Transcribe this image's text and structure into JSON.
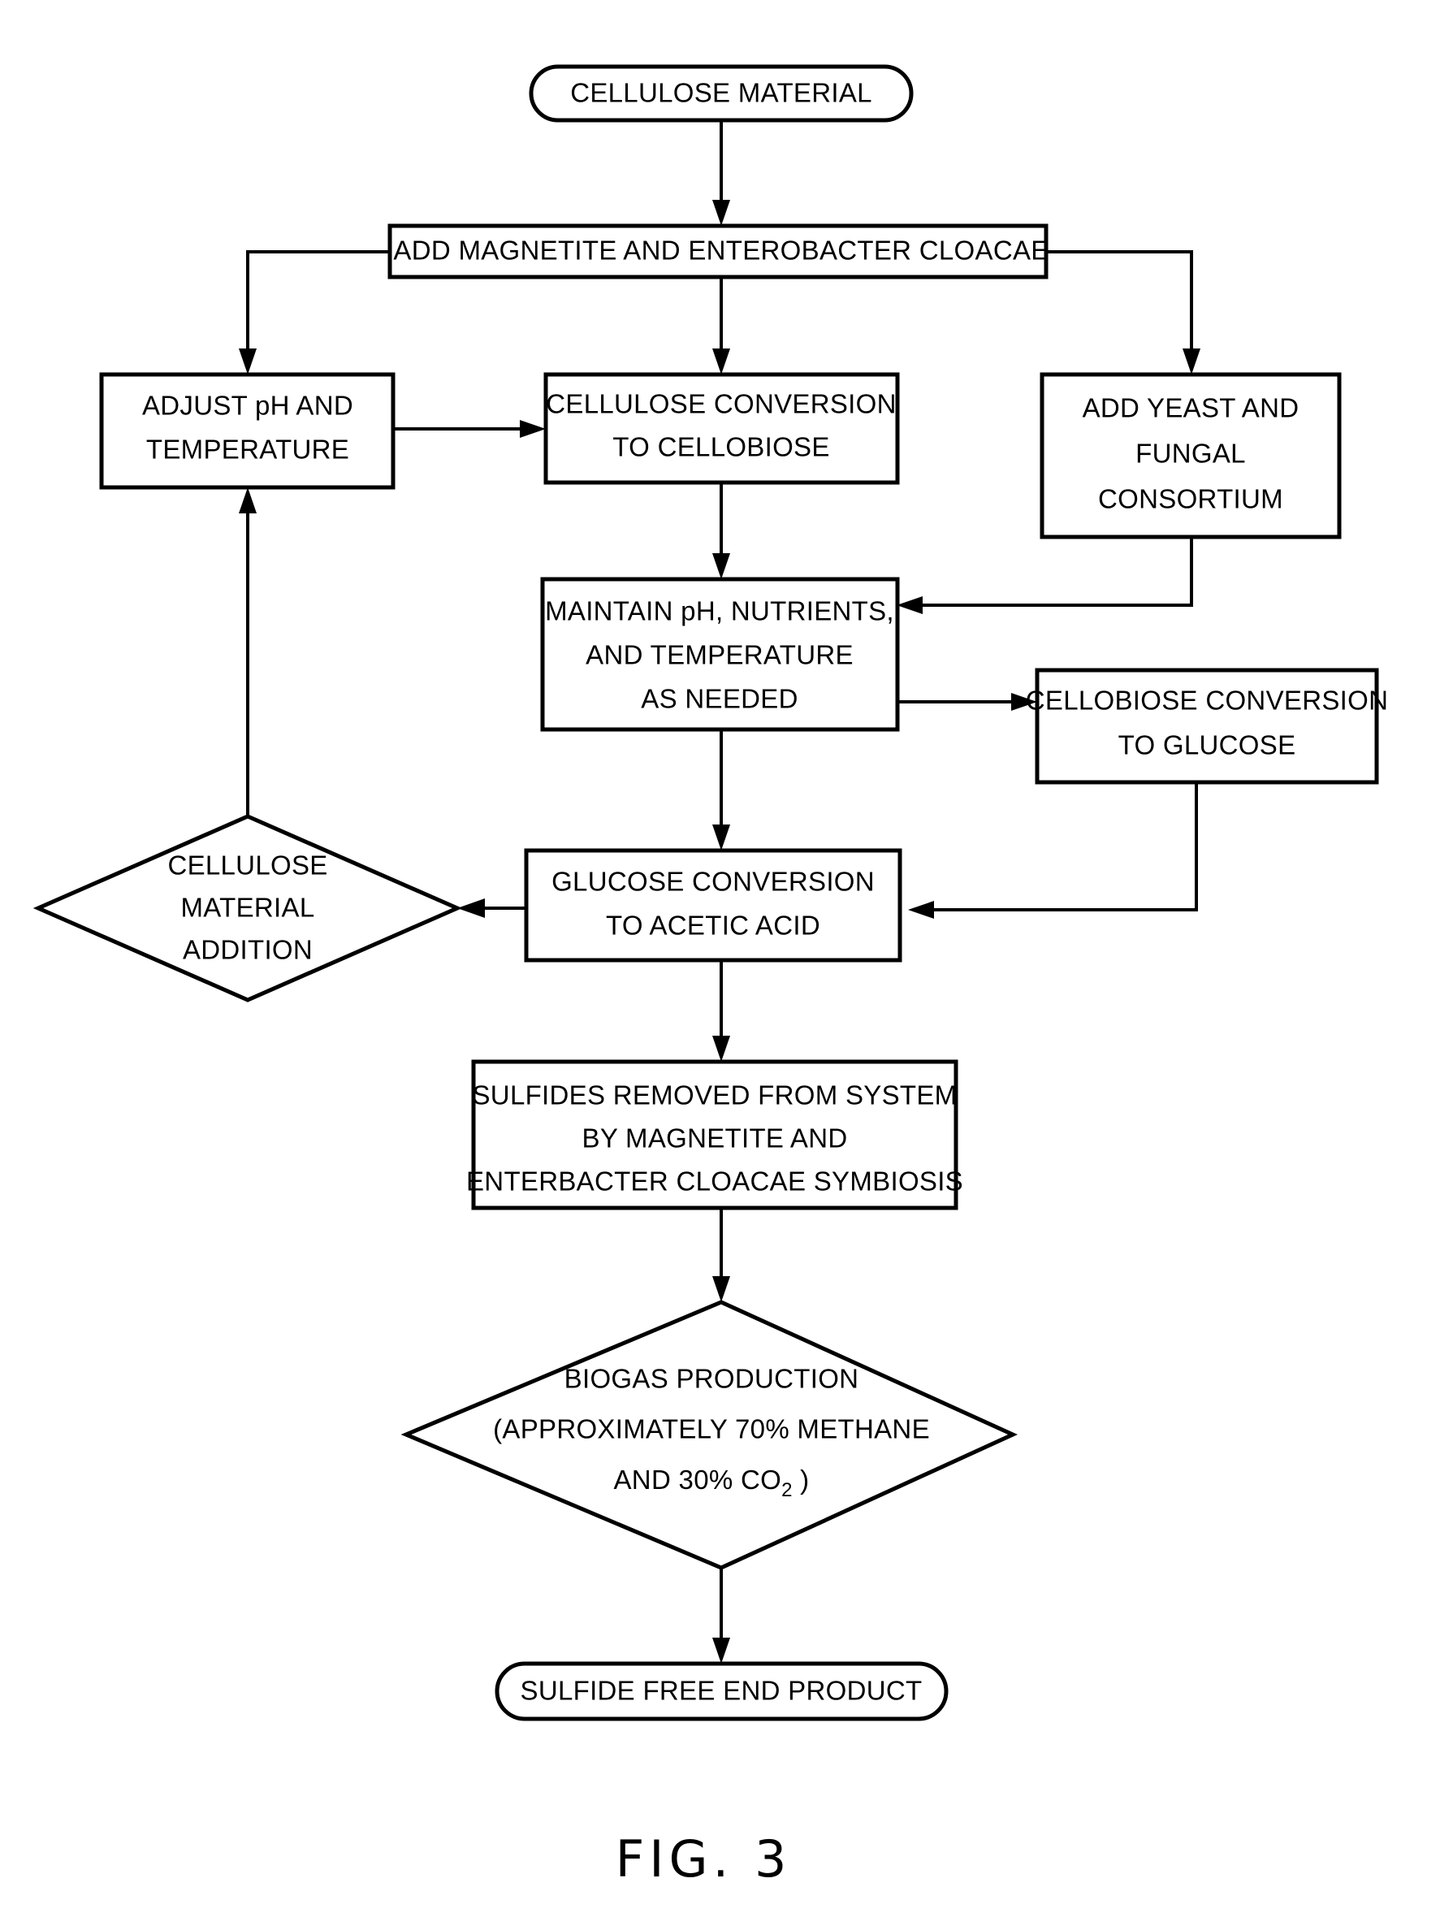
{
  "figure": {
    "label": "FIG. 3",
    "title": "Cellulose to biogas process flowchart"
  },
  "nodes": {
    "cellulose_material": {
      "shape": "stadium",
      "lines": [
        "CELLULOSE MATERIAL"
      ]
    },
    "add_magnetite": {
      "shape": "rect",
      "lines": [
        "ADD MAGNETITE AND ENTEROBACTER CLOACAE"
      ]
    },
    "adjust_ph": {
      "shape": "rect",
      "lines": [
        "ADJUST pH AND",
        "TEMPERATURE"
      ]
    },
    "cellulose_conversion": {
      "shape": "rect",
      "lines": [
        "CELLULOSE CONVERSION",
        "TO CELLOBIOSE"
      ]
    },
    "add_yeast": {
      "shape": "rect",
      "lines": [
        "ADD YEAST AND",
        "FUNGAL",
        "CONSORTIUM"
      ]
    },
    "maintain": {
      "shape": "rect",
      "lines": [
        "MAINTAIN pH, NUTRIENTS,",
        "AND TEMPERATURE",
        "AS NEEDED"
      ]
    },
    "cellobiose_conversion": {
      "shape": "rect",
      "lines": [
        "CELLOBIOSE CONVERSION",
        "TO GLUCOSE"
      ]
    },
    "cellulose_addition": {
      "shape": "diamond",
      "lines": [
        "CELLULOSE",
        "MATERIAL",
        "ADDITION"
      ]
    },
    "glucose_conversion": {
      "shape": "rect",
      "lines": [
        "GLUCOSE CONVERSION",
        "TO ACETIC ACID"
      ]
    },
    "sulfides_removed": {
      "shape": "rect",
      "lines": [
        "SULFIDES REMOVED FROM SYSTEM",
        "BY MAGNETITE AND",
        "ENTERBACTER CLOACAE SYMBIOSIS"
      ]
    },
    "biogas_production": {
      "shape": "diamond",
      "lines": [
        "BIOGAS PRODUCTION",
        "(APPROXIMATELY 70% METHANE",
        "AND 30% CO2 )"
      ],
      "line3_prefix": "AND 30% CO",
      "line3_sub": "2",
      "line3_suffix": " )"
    },
    "end_product": {
      "shape": "stadium",
      "lines": [
        "SULFIDE FREE END PRODUCT"
      ]
    }
  },
  "colors": {
    "stroke": "#000000",
    "fill": "#ffffff",
    "background": "#ffffff"
  }
}
